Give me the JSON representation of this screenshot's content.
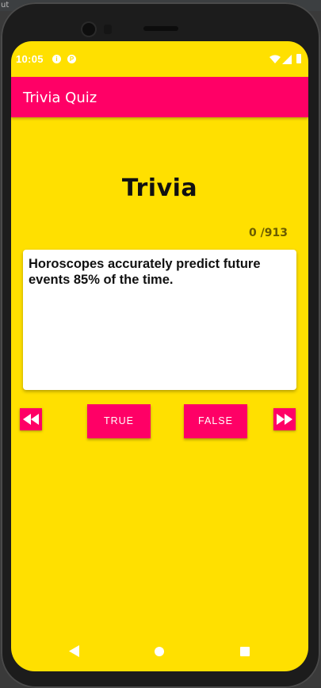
{
  "status": {
    "time": "10:05"
  },
  "app": {
    "title": "Trivia Quiz"
  },
  "quiz": {
    "heading": "Trivia",
    "counter": "0 /913",
    "question": "Horoscopes accurately predict future events 85% of the time.",
    "true_label": "TRUE",
    "false_label": "FALSE"
  },
  "colors": {
    "background": "#ffe000",
    "accent": "#ff0066",
    "card": "#ffffff"
  },
  "icons": {
    "prev": "rewind-icon",
    "next": "fast-forward-icon",
    "back": "back-triangle-icon",
    "home": "home-circle-icon",
    "recent": "recent-square-icon"
  }
}
